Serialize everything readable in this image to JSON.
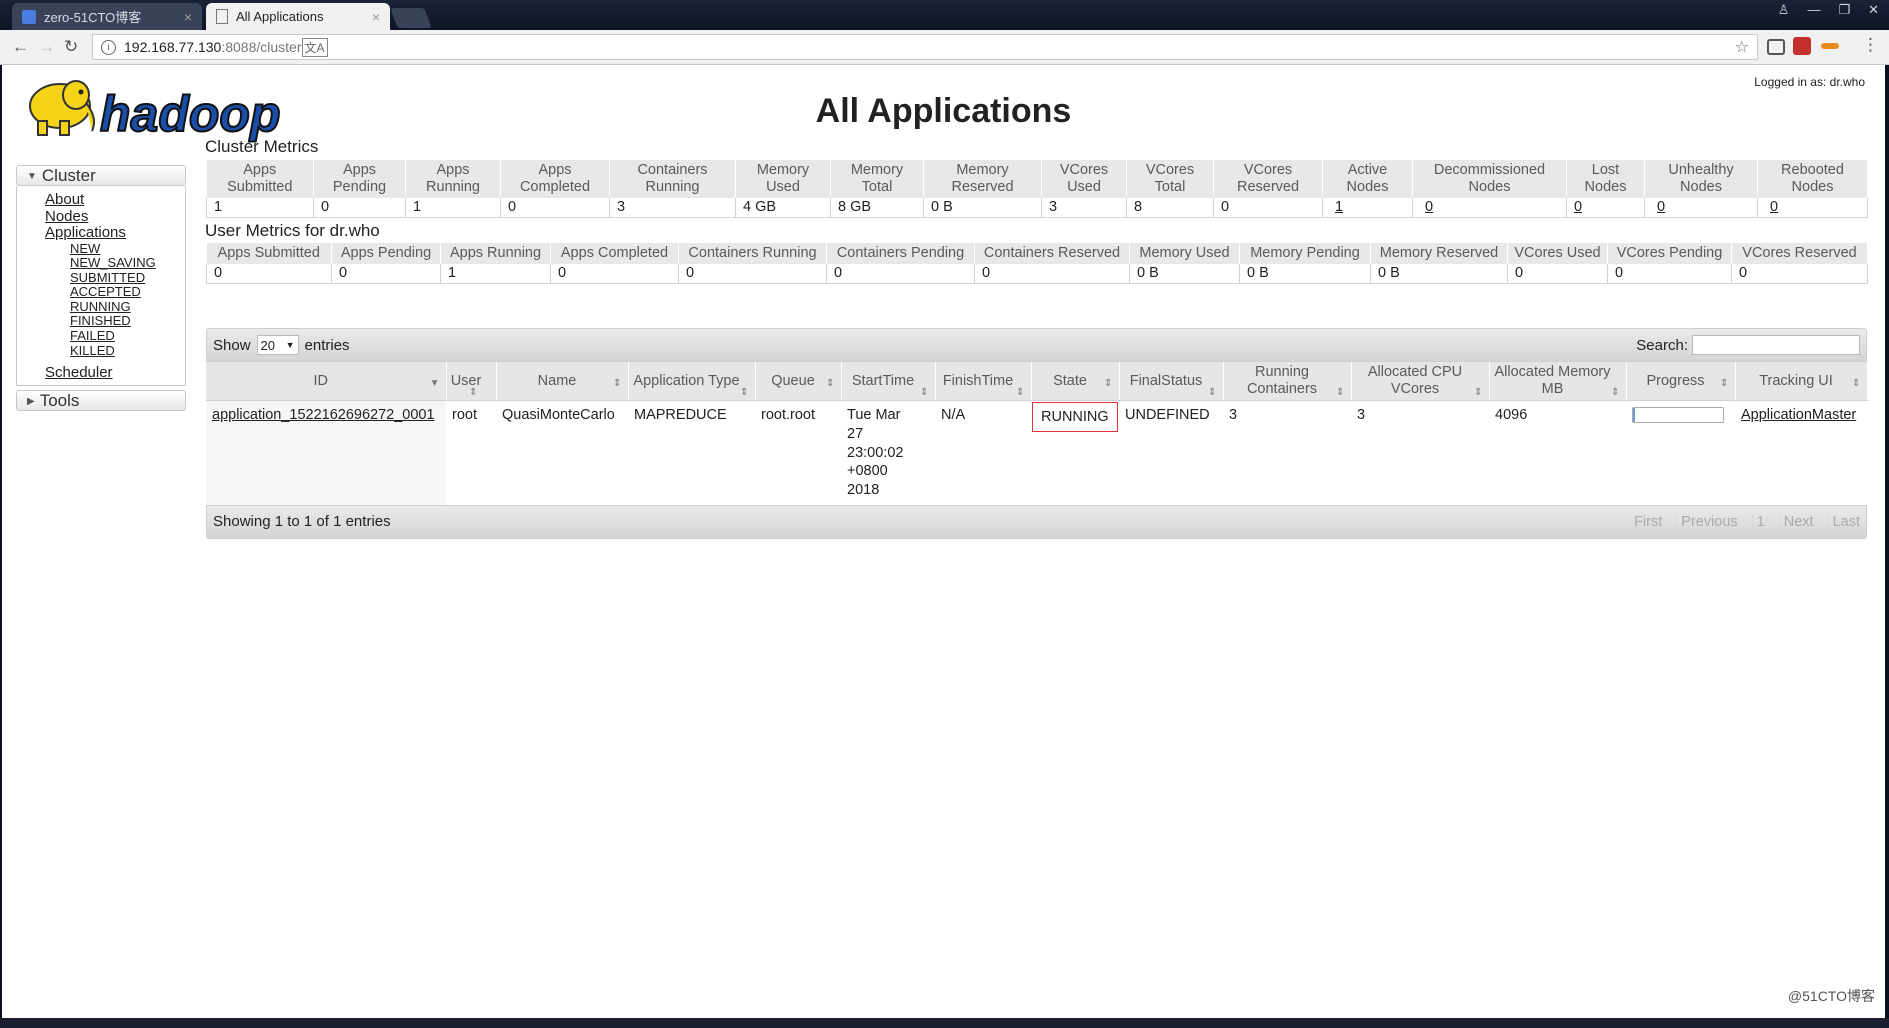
{
  "browser": {
    "tabs": [
      {
        "title": "zero-51CTO博客",
        "active": false
      },
      {
        "title": "All Applications",
        "active": true
      }
    ],
    "url_host": "192.168.77.130",
    "url_path": ":8088/cluster",
    "window_buttons": [
      "min",
      "max",
      "close"
    ]
  },
  "header": {
    "logo_text": "hadoop",
    "logged_in": "Logged in as: dr.who",
    "title": "All Applications"
  },
  "nav": {
    "cluster_label": "Cluster",
    "cluster_links": [
      "About",
      "Nodes",
      "Applications"
    ],
    "app_states": [
      "NEW",
      "NEW_SAVING",
      "SUBMITTED",
      "ACCEPTED",
      "RUNNING",
      "FINISHED",
      "FAILED",
      "KILLED"
    ],
    "scheduler": "Scheduler",
    "tools_label": "Tools"
  },
  "cluster_metrics": {
    "title": "Cluster Metrics",
    "headers": [
      "Apps Submitted",
      "Apps Pending",
      "Apps Running",
      "Apps Completed",
      "Containers Running",
      "Memory Used",
      "Memory Total",
      "Memory Reserved",
      "VCores Used",
      "VCores Total",
      "VCores Reserved",
      "Active Nodes",
      "Decommissioned Nodes",
      "Lost Nodes",
      "Unhealthy Nodes",
      "Rebooted Nodes"
    ],
    "values": [
      "1",
      "0",
      "1",
      "0",
      "3",
      "4 GB",
      "8 GB",
      "0 B",
      "3",
      "8",
      "0",
      "1",
      "0",
      "0",
      "0",
      "0"
    ]
  },
  "user_metrics": {
    "title": "User Metrics for dr.who",
    "headers": [
      "Apps Submitted",
      "Apps Pending",
      "Apps Running",
      "Apps Completed",
      "Containers Running",
      "Containers Pending",
      "Containers Reserved",
      "Memory Used",
      "Memory Pending",
      "Memory Reserved",
      "VCores Used",
      "VCores Pending",
      "VCores Reserved"
    ],
    "values": [
      "0",
      "0",
      "1",
      "0",
      "0",
      "0",
      "0",
      "0 B",
      "0 B",
      "0 B",
      "0",
      "0",
      "0"
    ]
  },
  "apps_table": {
    "show_label": "Show",
    "entries_value": "20",
    "entries_label": "entries",
    "search_label": "Search:",
    "columns": [
      "ID",
      "User",
      "Name",
      "Application Type",
      "Queue",
      "StartTime",
      "FinishTime",
      "State",
      "FinalStatus",
      "Running Containers",
      "Allocated CPU VCores",
      "Allocated Memory MB",
      "Progress",
      "Tracking UI"
    ],
    "rows": [
      {
        "id": "application_1522162696272_0001",
        "user": "root",
        "name": "QuasiMonteCarlo",
        "type": "MAPREDUCE",
        "queue": "root.root",
        "start_time": [
          "Tue Mar",
          "27",
          "23:00:02",
          "+0800",
          "2018"
        ],
        "finish_time": "N/A",
        "state": "RUNNING",
        "final_status": "UNDEFINED",
        "running_containers": "3",
        "allocated_vcores": "3",
        "allocated_memory": "4096",
        "progress": 0.02,
        "tracking_ui": "ApplicationMaster"
      }
    ],
    "info": "Showing 1 to 1 of 1 entries",
    "pager": [
      "First",
      "Previous",
      "1",
      "Next",
      "Last"
    ]
  },
  "watermark": "@51CTO博客",
  "colors": {
    "highlight_border": "#e3343a",
    "header_bg": "#e6e6e6",
    "logo_yellow": "#f5d318"
  }
}
